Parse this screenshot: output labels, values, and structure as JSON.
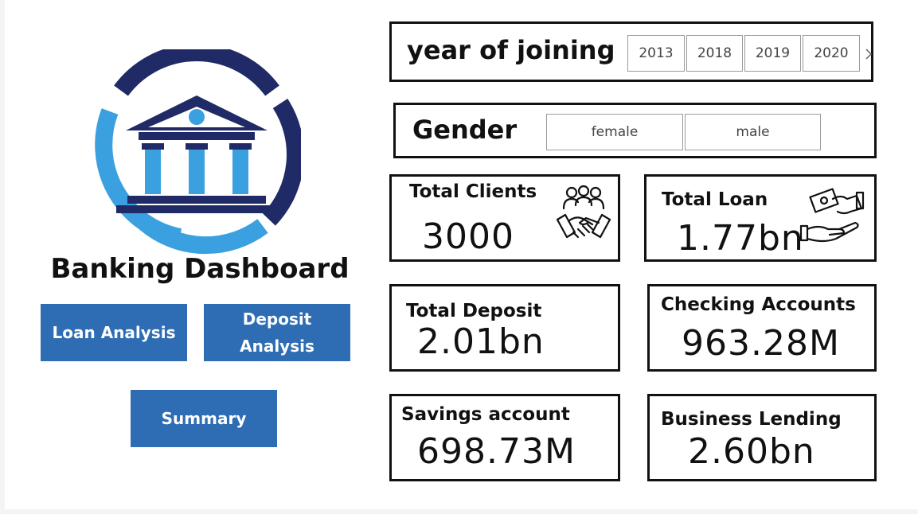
{
  "app": {
    "title": "Banking Dashboard",
    "logo_icon": "bank-building-icon",
    "accent_color": "#2e6db3",
    "logo_navy": "#1f2a66",
    "logo_blue": "#3aa0e0"
  },
  "nav": {
    "loan_analysis": "Loan Analysis",
    "deposit_analysis_line1": "Deposit",
    "deposit_analysis_line2": "Analysis",
    "summary": "Summary"
  },
  "filters": {
    "year": {
      "title": "year of joining",
      "options": [
        "2013",
        "2018",
        "2019",
        "2020"
      ],
      "scroll_icon": "chevron-right-icon"
    },
    "gender": {
      "title": "Gender",
      "options": [
        "female",
        "male"
      ]
    }
  },
  "kpis": {
    "total_clients": {
      "label": "Total Clients",
      "value": "3000",
      "icon": "clients-handshake-icon"
    },
    "total_loan": {
      "label": "Total Loan",
      "value": "1.77bn",
      "icon": "money-hand-icon"
    },
    "total_deposit": {
      "label": "Total Deposit",
      "value": "2.01bn"
    },
    "checking_accounts": {
      "label": "Checking Accounts",
      "value": "963.28M"
    },
    "savings_account": {
      "label": "Savings account",
      "value": "698.73M"
    },
    "business_lending": {
      "label": "Business Lending",
      "value": "2.60bn"
    }
  }
}
